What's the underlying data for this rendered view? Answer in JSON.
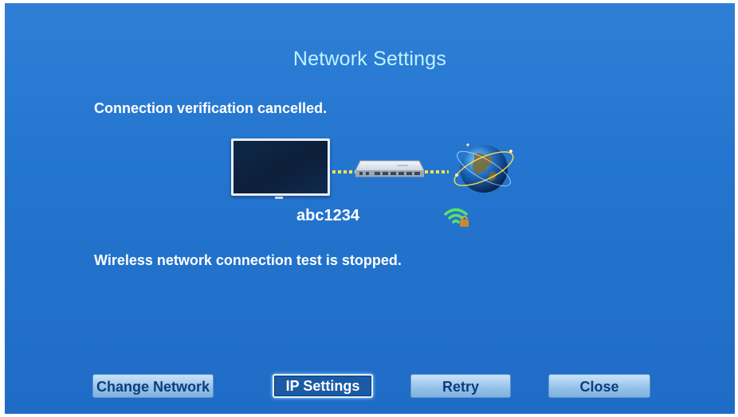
{
  "dialog": {
    "title": "Network Settings",
    "status_message": "Connection verification cancelled.",
    "test_message": "Wireless network connection test is stopped."
  },
  "network": {
    "ssid": "abc1234",
    "device_icon": "tv-icon",
    "router_icon": "router-icon",
    "internet_icon": "globe-icon",
    "signal_icon": "wifi-lock-icon"
  },
  "buttons": {
    "change_network": "Change Network",
    "ip_settings": "IP Settings",
    "retry": "Retry",
    "close": "Close"
  },
  "colors": {
    "background": "#2475cf",
    "title_text": "#bff4ff",
    "connection_dots": "#ffe34a",
    "wifi_signal": "#58e06b",
    "focused_button": "#1b5ba6"
  }
}
